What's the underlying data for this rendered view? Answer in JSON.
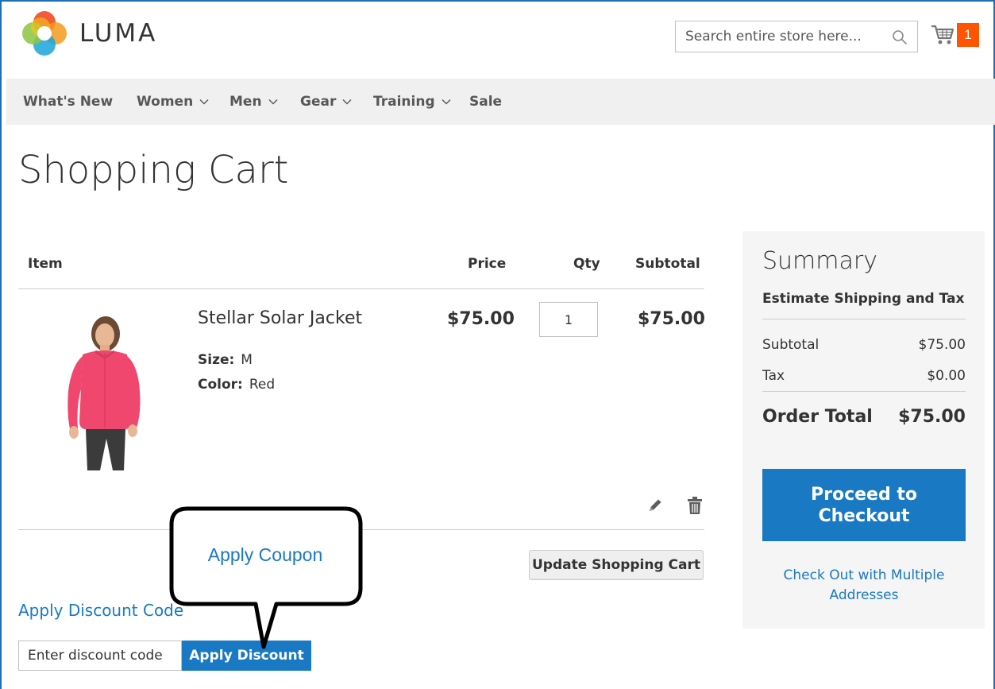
{
  "header": {
    "logo_text": "LUMA",
    "search": {
      "placeholder": "Search entire store here..."
    },
    "cart_count": "1"
  },
  "nav": {
    "items": [
      {
        "label": "What's New",
        "has_dropdown": false
      },
      {
        "label": "Women",
        "has_dropdown": true
      },
      {
        "label": "Men",
        "has_dropdown": true
      },
      {
        "label": "Gear",
        "has_dropdown": true
      },
      {
        "label": "Training",
        "has_dropdown": true
      },
      {
        "label": "Sale",
        "has_dropdown": false
      }
    ]
  },
  "page": {
    "title": "Shopping Cart"
  },
  "cart": {
    "headers": {
      "item": "Item",
      "price": "Price",
      "qty": "Qty",
      "subtotal": "Subtotal"
    },
    "items": [
      {
        "name": "Stellar Solar Jacket",
        "options": [
          {
            "label": "Size:",
            "value": "M"
          },
          {
            "label": "Color:",
            "value": "Red"
          }
        ],
        "price": "$75.00",
        "qty": "1",
        "subtotal": "$75.00"
      }
    ],
    "update_label": "Update Shopping Cart"
  },
  "discount": {
    "title": "Apply Discount Code",
    "placeholder": "Enter discount code",
    "button_label": "Apply Discount"
  },
  "callout": {
    "text": "Apply Coupon"
  },
  "summary": {
    "title": "Summary",
    "estimate_label": "Estimate Shipping and Tax",
    "rows": [
      {
        "label": "Subtotal",
        "value": "$75.00"
      },
      {
        "label": "Tax",
        "value": "$0.00"
      }
    ],
    "total_label": "Order Total",
    "total_value": "$75.00",
    "checkout_label": "Proceed to Checkout",
    "multi_address_label": "Check Out with Multiple Addresses"
  },
  "colors": {
    "accent": "#1979c3",
    "cart_badge": "#ff5501",
    "nav_bg": "#f0f0f0",
    "summary_bg": "#f5f5f5",
    "product_jacket": "#f0476e"
  }
}
